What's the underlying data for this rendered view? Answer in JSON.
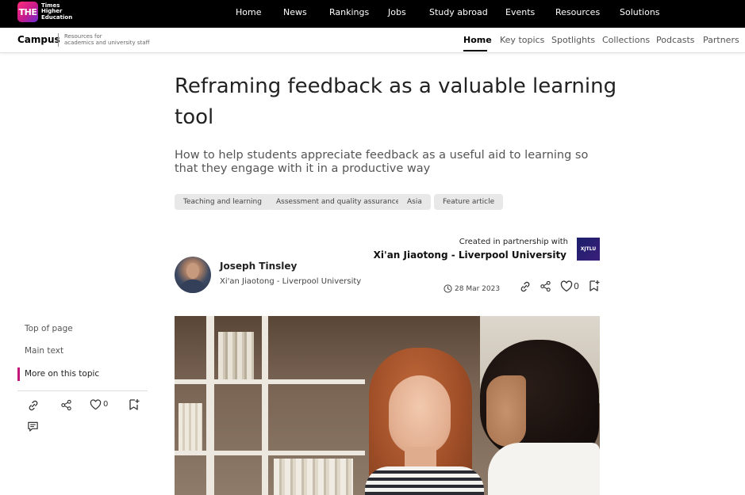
{
  "topbar": {
    "logo_mark": "THE",
    "logo_lines": [
      "Times",
      "Higher",
      "Education"
    ],
    "nav": [
      "Home",
      "News",
      "Rankings",
      "Jobs",
      "Study abroad",
      "Events",
      "Resources",
      "Solutions"
    ]
  },
  "campus": {
    "title": "Campus",
    "subtitle_lines": [
      "Resources for",
      "academics and university staff"
    ],
    "nav": [
      "Home",
      "Key topics",
      "Spotlights",
      "Collections",
      "Podcasts",
      "Partners"
    ],
    "active": "Home"
  },
  "article": {
    "title": "Reframing feedback as a valuable learning tool",
    "subtitle": "How to help students appreciate feedback as a useful aid to learning so that they engage with it in a productive way",
    "tags": [
      "Teaching and learning",
      "Assessment and quality assurance",
      "Asia",
      "Feature article"
    ],
    "partner_label": "Created in partnership with",
    "partner_name": "Xi'an Jiaotong - Liverpool University",
    "partner_logo_text": "XJTLU",
    "author_name": "Joseph Tinsley",
    "author_affiliation": "Xi'an Jiaotong - Liverpool University",
    "date": "28 Mar 2023",
    "like_count": "0"
  },
  "sidebar": {
    "links": [
      "Top of page",
      "Main text",
      "More on this topic"
    ],
    "active": "More on this topic",
    "like_count": "0"
  },
  "colors": {
    "accent": "#c4167a",
    "topbar_bg": "#000000",
    "tag_bg": "#e8e8e8"
  },
  "icons": {
    "article_actions": [
      "link-icon",
      "share-icon",
      "heart-icon",
      "bookmark-add-icon"
    ],
    "sidebar_actions": [
      "link-icon",
      "share-icon",
      "heart-icon",
      "bookmark-add-icon",
      "comment-icon"
    ],
    "date": "clock-icon"
  }
}
